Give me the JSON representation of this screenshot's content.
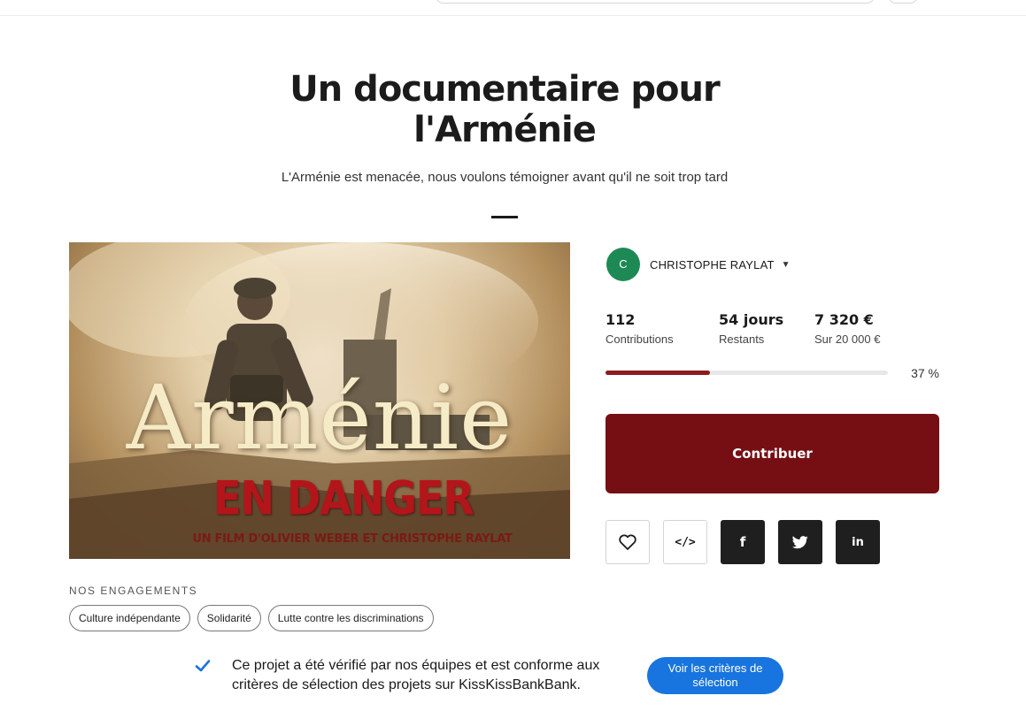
{
  "project": {
    "title": "Un documentaire pour l'Arménie",
    "subtitle": "L'Arménie est menacée, nous voulons témoigner avant qu'il ne soit trop tard"
  },
  "hero": {
    "title": "Arménie",
    "subtitle": "EN DANGER",
    "credit": "UN FILM D'OLIVIER WEBER ET CHRISTOPHE RAYLAT"
  },
  "owner": {
    "initial": "C",
    "name": "CHRISTOPHE RAYLAT",
    "avatar_color": "#1d8a55"
  },
  "stats": {
    "contributions": {
      "value": "112",
      "label": "Contributions"
    },
    "days": {
      "value": "54 jours",
      "label": "Restants"
    },
    "amount": {
      "value": "7 320 €",
      "label": "Sur 20 000 €"
    }
  },
  "progress": {
    "percent": 37,
    "label": "37 %",
    "color": "#8c1b1f"
  },
  "cta": {
    "label": "Contribuer",
    "color": "#760f14"
  },
  "share": {
    "buttons": [
      "heart-icon",
      "embed-icon",
      "facebook-icon",
      "twitter-icon",
      "linkedin-icon"
    ],
    "embed_label": "</>",
    "facebook_label": "f",
    "linkedin_label": "in"
  },
  "engagements": {
    "label": "NOS ENGAGEMENTS",
    "tags": [
      "Culture indépendante",
      "Solidarité",
      "Lutte contre les discriminations"
    ]
  },
  "verification": {
    "text": "Ce projet a été vérifié par nos équipes et est conforme aux critères de sélection des projets sur KissKissBankBank.",
    "button_label": "Voir les critères de sélection",
    "accent_color": "#1874de"
  }
}
